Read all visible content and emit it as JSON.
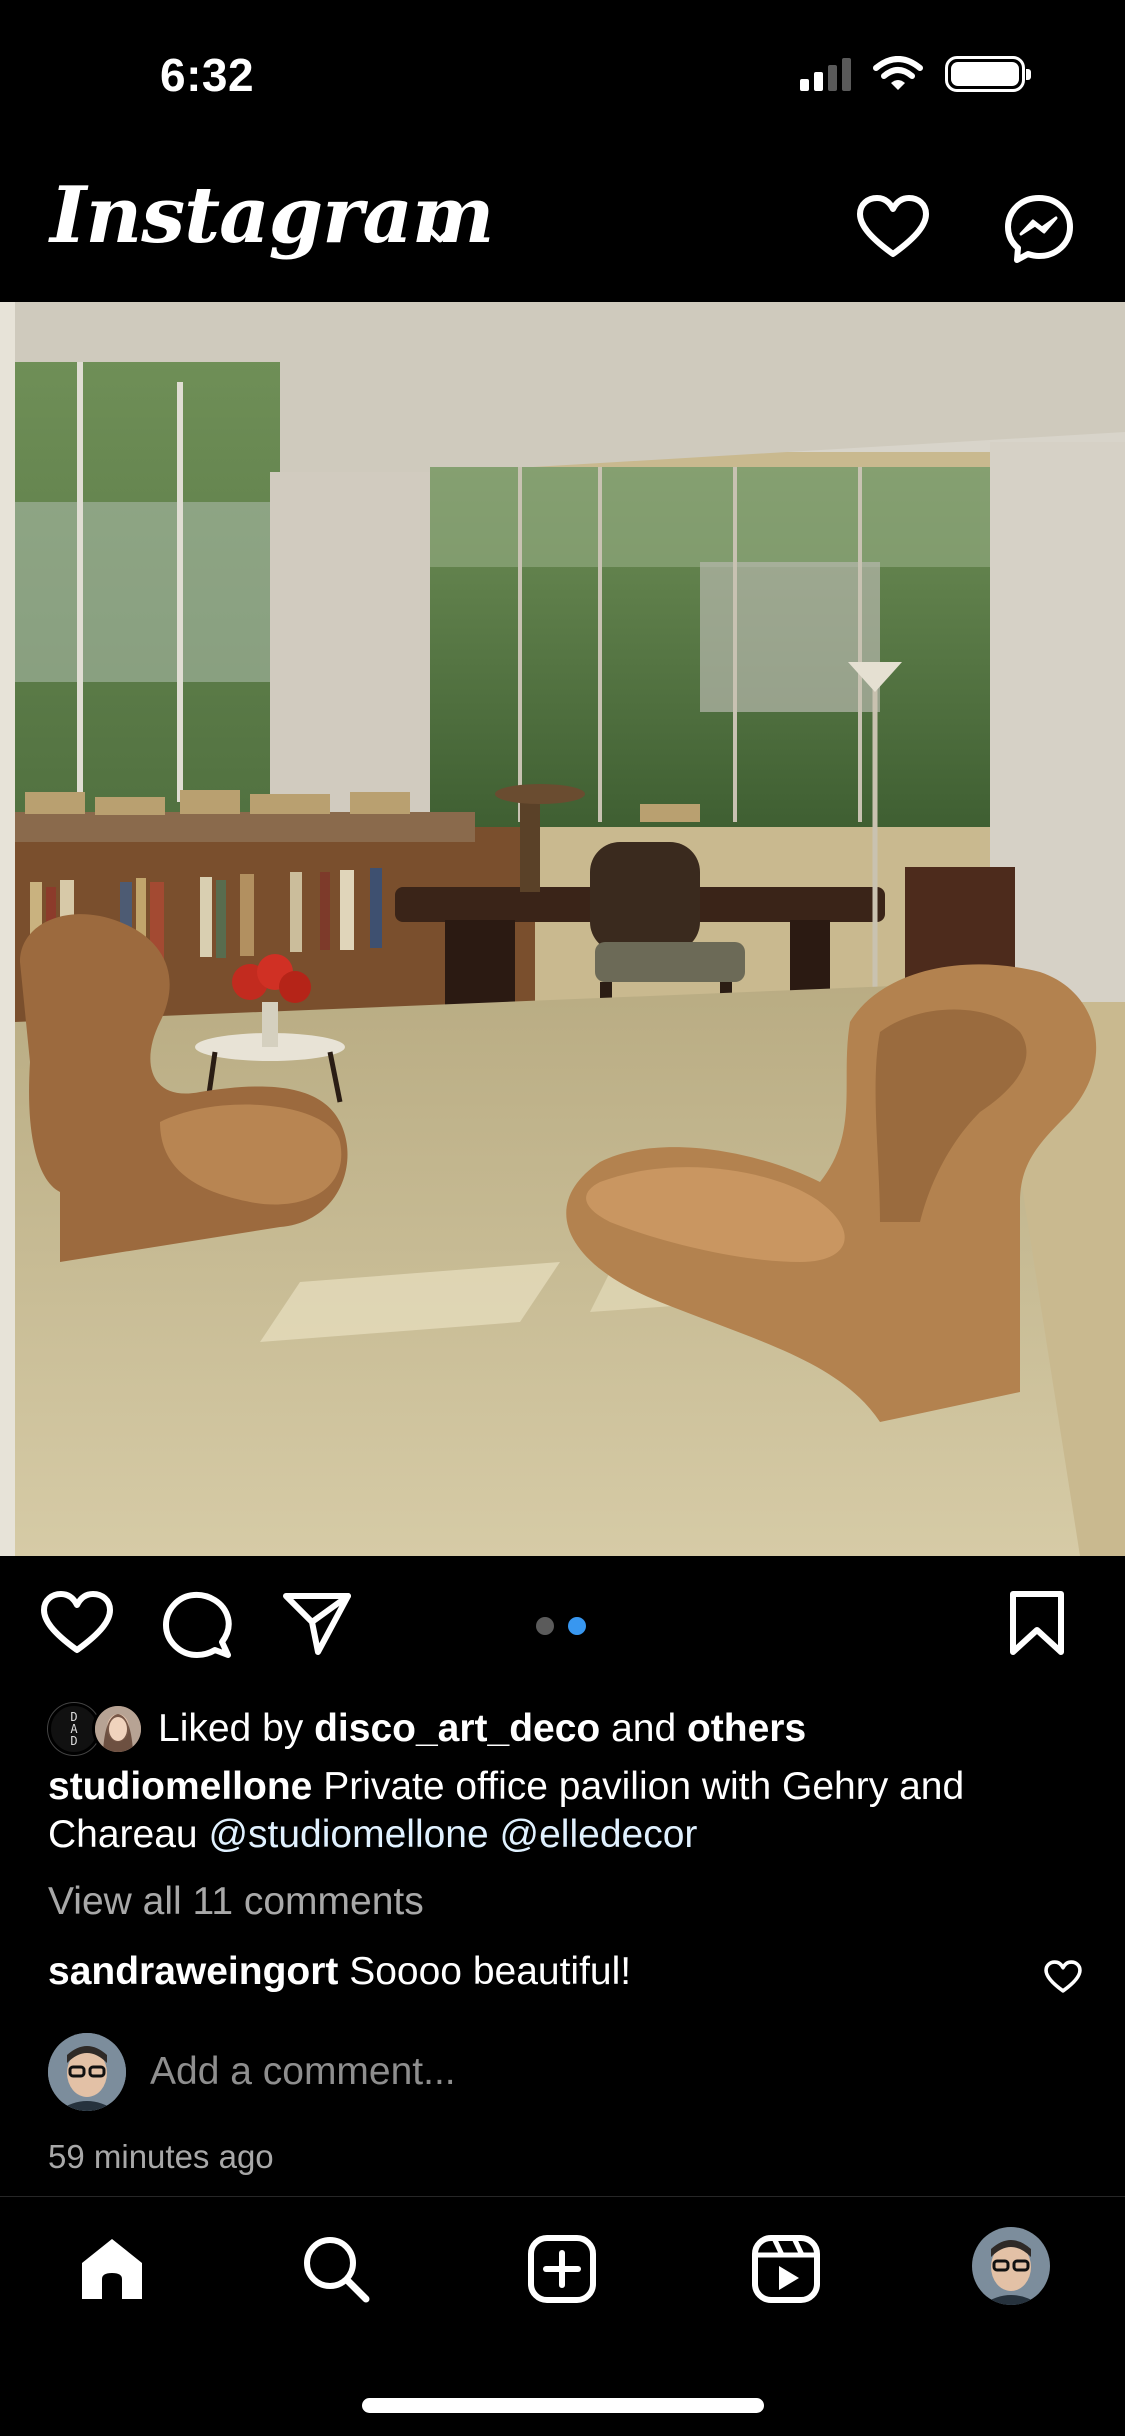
{
  "status_bar": {
    "time": "6:32",
    "icons": [
      "cellular-signal-icon",
      "wifi-icon",
      "battery-icon"
    ]
  },
  "header": {
    "logo": "Instagram",
    "icons": [
      "chevron-down-icon",
      "heart-icon",
      "messenger-icon"
    ]
  },
  "post": {
    "image_alt": "Private office pavilion interior with cardboard wiggle chairs, bookshelves and desk",
    "carousel": {
      "count": 2,
      "active_index": 1
    },
    "actions": [
      "like-icon",
      "comment-icon",
      "share-icon",
      "bookmark-icon"
    ],
    "likes": {
      "prefix": "Liked by ",
      "user": "disco_art_deco",
      "and": " and ",
      "others": "others",
      "avatar_text": "D\nA\nD"
    },
    "caption": {
      "username": "studiomellone",
      "text": " Private office pavilion with Gehry and Chareau ",
      "mention1": "@studiomellone",
      "space": " ",
      "mention2": "@elledecor"
    },
    "view_comments": "View all 11 comments",
    "top_comment": {
      "username": "sandraweingort",
      "text": " Soooo beautiful!"
    },
    "add_comment_placeholder": "Add a comment...",
    "timestamp": "59 minutes ago"
  },
  "tabbar": {
    "items": [
      "home-icon",
      "search-icon",
      "create-icon",
      "reels-icon",
      "profile-avatar"
    ],
    "active": "home-icon"
  },
  "colors": {
    "background": "#000000",
    "accent_blue": "#3897f0",
    "secondary_text": "#a8a8a8"
  }
}
